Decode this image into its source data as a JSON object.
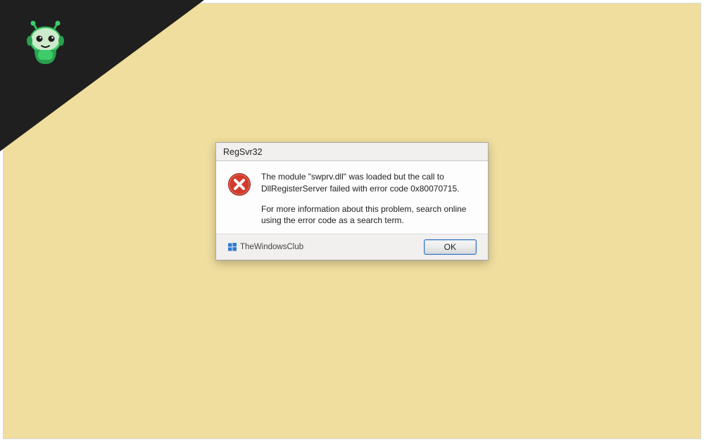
{
  "dialog": {
    "title": "RegSvr32",
    "message_line1": "The module \"swprv.dll\" was loaded but the call to DllRegisterServer failed with error code 0x80070715.",
    "message_line2": "For more information about this problem, search online using the error code as a search term.",
    "ok_label": "OK",
    "brand_label": "TheWindowsClub"
  },
  "colors": {
    "background": "#f0de9e",
    "corner": "#1f1f1f",
    "robot_body": "#3ecb6a",
    "robot_dark": "#2aa04f",
    "error_red": "#d13a2b",
    "button_border": "#3573c1"
  },
  "icons": {
    "robot": "robot-mascot-icon",
    "error": "error-x-icon",
    "brand": "windows-flag-icon"
  }
}
